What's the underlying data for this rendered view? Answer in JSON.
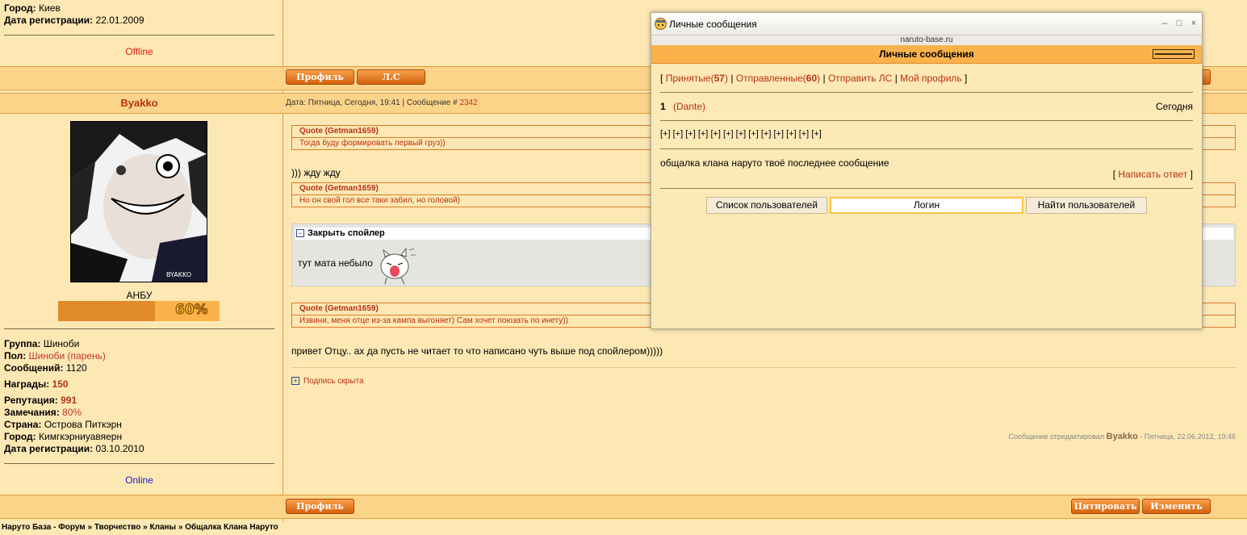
{
  "user1": {
    "city_label": "Город:",
    "city": "Киев",
    "reg_label": "Дата регистрации:",
    "reg": "22.01.2009",
    "status": "Offline"
  },
  "buttons": {
    "profile": "Профиль",
    "pm": "Л.С",
    "quote": "Цитировать",
    "edit": "Изменить"
  },
  "post": {
    "username": "Byakko",
    "header_prefix": "Дата: Пятница, Сегодня, 19:41 | Сообщение #",
    "number": "2342",
    "rank": "АНБУ",
    "rank_progress": "60%",
    "rank_progress_value": 0.6,
    "avatar_signature": "BYAKKO",
    "info": {
      "group_label": "Группа:",
      "group": "Шиноби",
      "sex_label": "Пол:",
      "sex": "Шиноби (парень)",
      "posts_label": "Сообщений:",
      "posts": "1120",
      "awards_label": "Награды:",
      "awards": "150",
      "rep_label": "Репутация:",
      "rep": "991",
      "warn_label": "Замечания:",
      "warn": "80%",
      "country_label": "Страна:",
      "country": "Острова Питкэрн",
      "city_label": "Город:",
      "city": "Кимгкэрниуавяерн",
      "reg_label": "Дата регистрации:",
      "reg": "03.10.2010"
    },
    "status": "Online",
    "quote_label": "Quote (Getman1659)",
    "quote1": "Тогда буду формировать первый груз))",
    "text1": "))) жду жду",
    "quote2": "Но он свой гол все таки забил, но головой)",
    "spoiler_title": "Закрыть спойлер",
    "spoiler_text": "тут мата небыло",
    "quote3": "Извини, меня отце из-за кампа выгоняет) Сам хочет поюзать по инету))",
    "text2": "привет Отцу.. ах да пусть не читает то что написано чуть выше под спойлером)))))",
    "signature_hidden": "Подпись скрыта",
    "edited_prefix": "Сообщение отредактировал",
    "edited_user": "Byakko",
    "edited_suffix": "- Пятница, 22.06.2012, 19:46"
  },
  "breadcrumb": {
    "items": [
      "Наруто База - Форум",
      "Творчество",
      "Кланы",
      "Общалка Клана Наруто"
    ],
    "sep": "»"
  },
  "popup": {
    "window_title": "Личные сообщения",
    "domain": "naruto-base.ru",
    "header": "Личные сообщения",
    "nav": {
      "open": "[",
      "close": "]",
      "sep": "|",
      "inbox": "Принятые",
      "inbox_count": "57",
      "sent": "Отправленные",
      "sent_count": "60",
      "send": "Отправить ЛС",
      "profile": "Мой профиль"
    },
    "message": {
      "num": "1",
      "author": "(Dante)",
      "date": "Сегодня",
      "expanders": [
        "[+]",
        "[+]",
        "[+]",
        "[+]",
        "[+]",
        "[+]",
        "[+]",
        "[+]",
        "[+]",
        "[+]",
        "[+]",
        "[+]",
        "[+]"
      ],
      "text": "общалка клана наруто твоё последнее сообщение",
      "reply": "Написать ответ"
    },
    "user_list_button": "Список пользователей",
    "login_input": "Логин",
    "find_button": "Найти пользователей"
  }
}
